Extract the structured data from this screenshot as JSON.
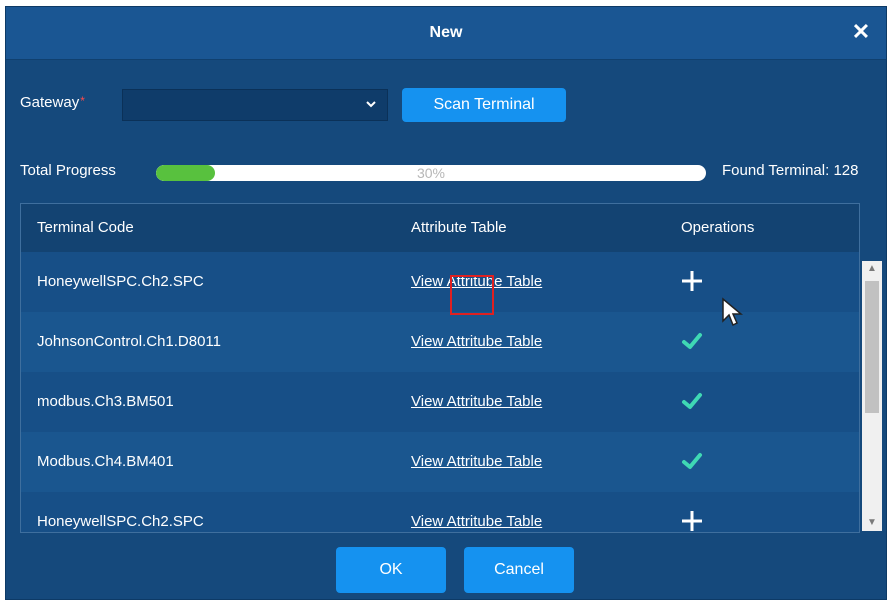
{
  "dialog": {
    "title": "New",
    "close_symbol": "✕"
  },
  "gateway": {
    "label": "Gateway",
    "required_mark": "*",
    "value": "",
    "scan_label": "Scan Terminal"
  },
  "progress": {
    "label": "Total Progress",
    "percent": 30,
    "text": "30%",
    "found_label": "Found Terminal: 128"
  },
  "table": {
    "headers": [
      "Terminal Code",
      "Attribute Table",
      "Operations"
    ],
    "rows": [
      {
        "code": "HoneywellSPC.Ch2.SPC",
        "link": "View Attritube Table",
        "op": "add-icon"
      },
      {
        "code": "JohnsonControl.Ch1.D8011",
        "link": "View Attritube Table",
        "op": "check-icon"
      },
      {
        "code": "modbus.Ch3.BM501",
        "link": "View Attritube Table",
        "op": "check-icon"
      },
      {
        "code": "Modbus.Ch4.BM401",
        "link": "View Attritube Table",
        "op": "check-icon"
      },
      {
        "code": "HoneywellSPC.Ch2.SPC",
        "link": "View Attritube Table",
        "op": "add-icon"
      }
    ]
  },
  "footer": {
    "ok_label": "OK",
    "cancel_label": "Cancel"
  },
  "colors": {
    "dialog_bg": "#15497c",
    "accent_button": "#1592f0",
    "progress_fill": "#58c13e",
    "check": "#3fd8b4",
    "highlight": "#e02020"
  }
}
